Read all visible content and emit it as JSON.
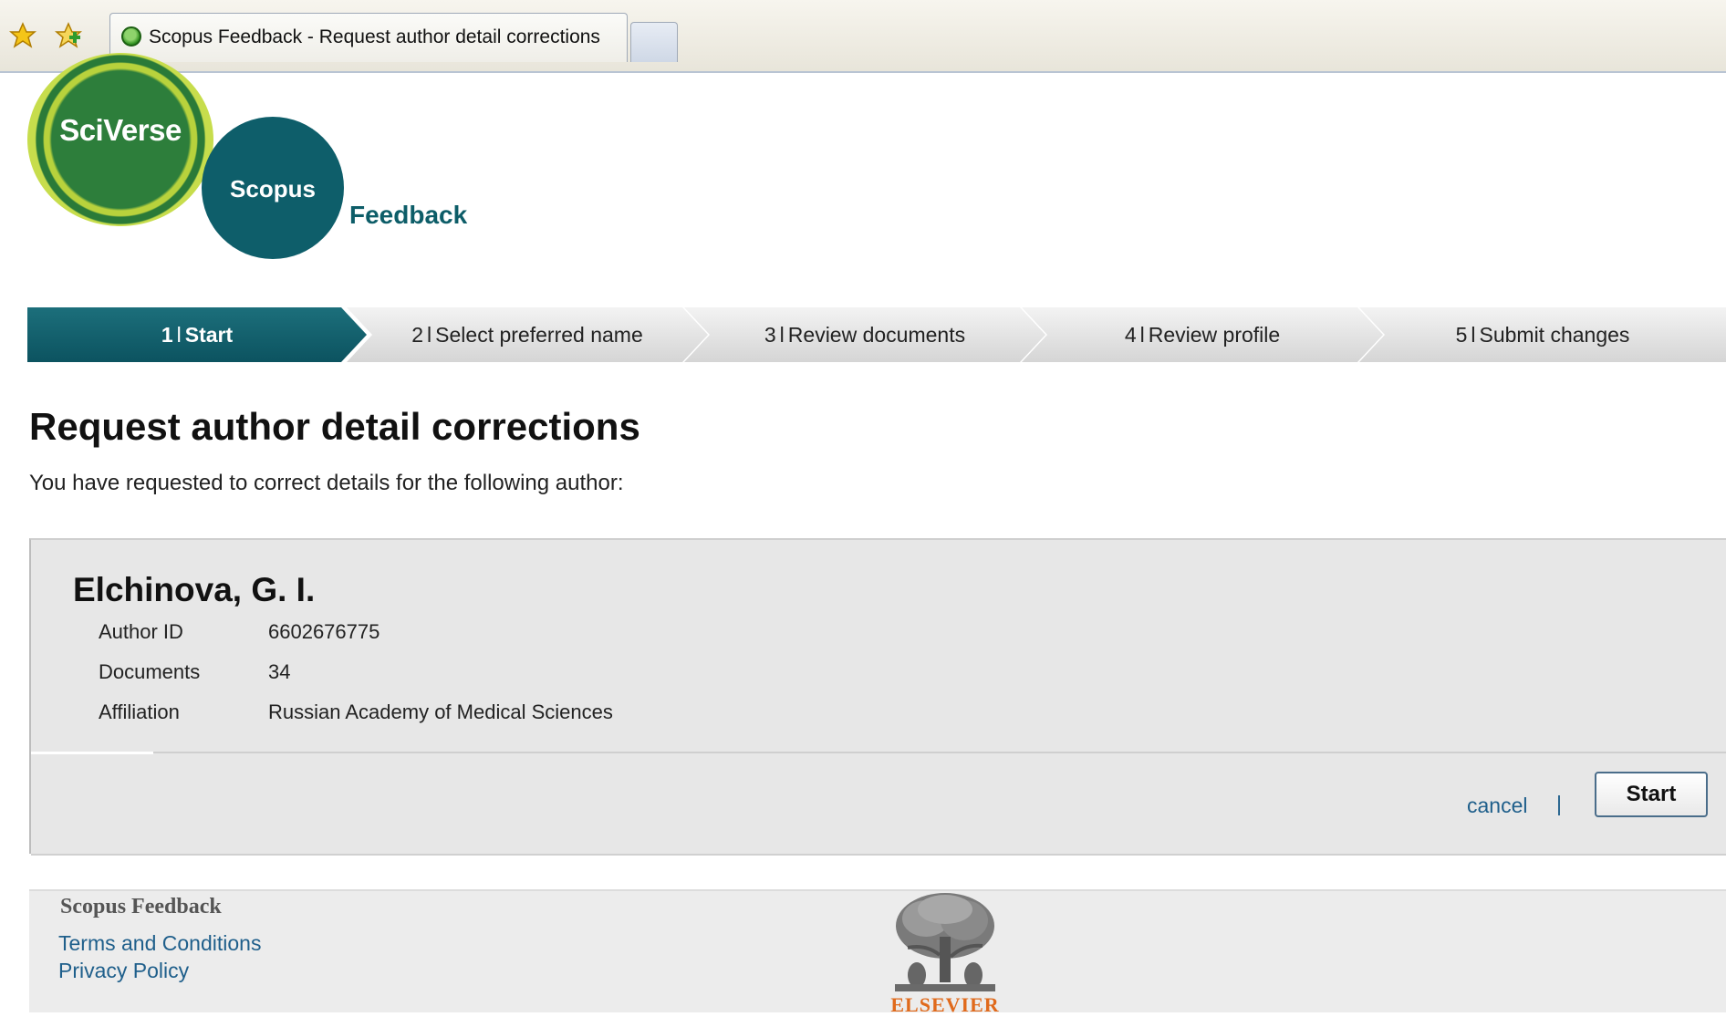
{
  "browser": {
    "tab_title": "Scopus Feedback - Request author detail corrections"
  },
  "logo": {
    "sciverse": "SciVerse",
    "scopus": "Scopus",
    "feedback": "Feedback"
  },
  "steps": [
    {
      "num": "1",
      "label": "Start",
      "active": true
    },
    {
      "num": "2",
      "label": "Select preferred name",
      "active": false
    },
    {
      "num": "3",
      "label": "Review documents",
      "active": false
    },
    {
      "num": "4",
      "label": "Review profile",
      "active": false
    },
    {
      "num": "5",
      "label": "Submit changes",
      "active": false
    }
  ],
  "step_separator": "l",
  "main": {
    "title": "Request author detail corrections",
    "subtitle": "You have requested to correct details for the following author:"
  },
  "author": {
    "name": "Elchinova, G. I.",
    "fields": [
      {
        "label": "Author ID",
        "value": "6602676775"
      },
      {
        "label": "Documents",
        "value": "34"
      },
      {
        "label": "Affiliation",
        "value": "Russian Academy of Medical Sciences"
      }
    ]
  },
  "actions": {
    "cancel_label": "cancel",
    "separator": "|",
    "start_label": "Start"
  },
  "footer": {
    "title": "Scopus Feedback",
    "terms_label": "Terms and Conditions",
    "privacy_label": "Privacy Policy",
    "publisher_logo_text": "ELSEVIER"
  },
  "colors": {
    "brand_teal": "#0d5d68",
    "link_blue": "#1f5f8b",
    "elsevier_orange": "#e06a1c"
  }
}
